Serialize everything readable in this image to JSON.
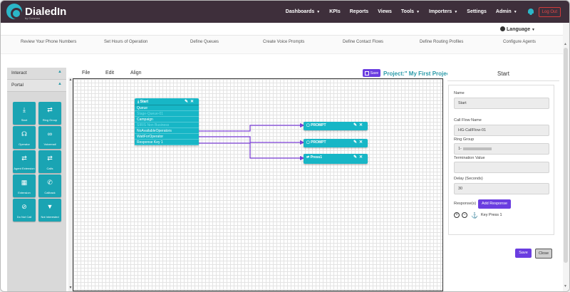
{
  "brand": {
    "name": "DialedIn",
    "tagline": "by Convoso"
  },
  "nav": {
    "items": [
      {
        "label": "Dashboards",
        "caret": true
      },
      {
        "label": "KPIs",
        "caret": false
      },
      {
        "label": "Reports",
        "caret": false
      },
      {
        "label": "Views",
        "caret": false
      },
      {
        "label": "Tools",
        "caret": true
      },
      {
        "label": "Importers",
        "caret": true
      },
      {
        "label": "Settings",
        "caret": false
      },
      {
        "label": "Admin",
        "caret": true
      }
    ],
    "logout": "Log Out"
  },
  "language": {
    "label": "Language"
  },
  "steps": [
    "Review Your Phone Numbers",
    "Set Hours of Operation",
    "Define Queues",
    "Create Voice Prompts",
    "Define Contact Flows",
    "Define Routing Profiles",
    "Configure Agents"
  ],
  "sidebar": {
    "sections": [
      {
        "label": "Interact"
      },
      {
        "label": "Portal"
      }
    ],
    "palette": [
      {
        "label": "Start",
        "icon": "download-icon"
      },
      {
        "label": "Ring Group",
        "icon": "arrows-icon"
      },
      {
        "label": "Operator",
        "icon": "headset-icon"
      },
      {
        "label": "Voicemail",
        "icon": "voicemail-icon"
      },
      {
        "label": "Agent Extension",
        "icon": "arrows-icon"
      },
      {
        "label": "Calls",
        "icon": "arrows-icon"
      },
      {
        "label": "Extension",
        "icon": "grid-icon"
      },
      {
        "label": "Callback",
        "icon": "phone-icon"
      },
      {
        "label": "Do Not Call",
        "icon": "ban-icon"
      },
      {
        "label": "Not Interested",
        "icon": "thumbs-down-icon"
      }
    ]
  },
  "toolbar": {
    "file": "File",
    "edit": "Edit",
    "align": "Align",
    "save": "Save",
    "project_title": "Project:\" My First Project"
  },
  "flow": {
    "start_node": {
      "title": "Start",
      "rows": [
        {
          "text": "Queue",
          "dim": false
        },
        {
          "text": "Stage-Queue-01",
          "dim": true
        },
        {
          "text": "Campaign",
          "dim": false
        },
        {
          "text": "SIRIS Non Business",
          "dim": true
        },
        {
          "text": "NoAvailableOperators",
          "dim": false
        },
        {
          "text": "WaitForOperator",
          "dim": false
        },
        {
          "text": "Response Key 1",
          "dim": false
        }
      ]
    },
    "targets": [
      {
        "title": "PROMPT",
        "icon": "file-icon"
      },
      {
        "title": "PROMPT",
        "icon": "file-icon"
      },
      {
        "title": "Press1",
        "icon": "arrows-icon"
      }
    ]
  },
  "panel": {
    "title": "Start",
    "name_label": "Name",
    "name_value": "Start",
    "callflow_label": "Call Flow Name",
    "callflow_value": "HG-CallFlow-01",
    "ringgroup_label": "Ring Group",
    "ringgroup_value": "1-",
    "termination_label": "Termination Value",
    "termination_value": "",
    "delay_label": "Delay (Seconds)",
    "delay_value": "30",
    "responses_label": "Response(s)",
    "add_response": "Add Response",
    "response_item": "Key Press 1",
    "save": "Save",
    "close": "Close"
  },
  "colors": {
    "nav_bg": "#3e2f3b",
    "teal": "#17b6c6",
    "purple": "#6a3de0",
    "wire": "#7b3fd6"
  }
}
